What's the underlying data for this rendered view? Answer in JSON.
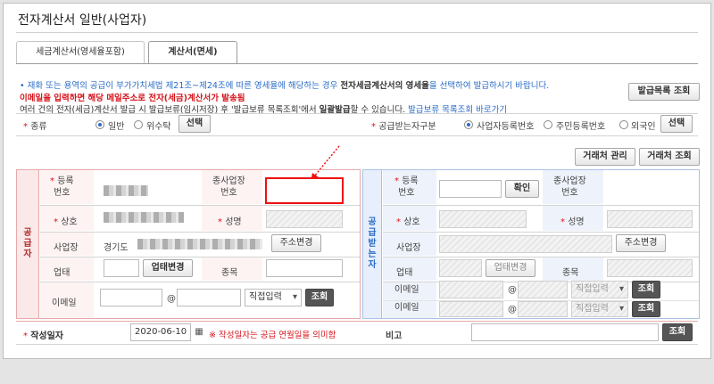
{
  "title": "전자계산서 일반(사업자)",
  "tabs": [
    "세금계산서(영세율포함)",
    "계산서(면세)"
  ],
  "notice": {
    "line1_prefix": "• 재화 또는 용역의 공급이 부가가치세법 제21조~제24조에 따른 영세율에 해당하는 경우 ",
    "line1_bold": "전자세금계산서의 영세율",
    "line1_suffix": "을 선택하여 발급하시기 바랍니다.",
    "line2": "이메일을 입력하면 해당 메일주소로 전자(세금)계산서가 발송됨",
    "line3_prefix": "여러 건의 전자(세금)계산서 발급 시 발급보류(임시저장) 후 '발급보류 목록조회'에서 ",
    "line3_bold": "일괄발급",
    "line3_mid": "할 수 있습니다. ",
    "line3_link": "발급보류 목록조회 바로가기"
  },
  "buttons": {
    "issue_list": "발급목록 조회",
    "select": "선택",
    "client_manage": "거래처 관리",
    "client_search": "거래처 조회",
    "confirm": "확인",
    "address_change": "주소변경",
    "business_change": "업태변경",
    "search": "조회"
  },
  "type_row": {
    "label": "종류",
    "options": [
      "일반",
      "위수탁"
    ],
    "selected": "일반",
    "receiver_label": "공급받는자구분",
    "receiver_options": [
      "사업자등록번호",
      "주민등록번호",
      "외국인"
    ],
    "receiver_selected": "사업자등록번호"
  },
  "supplier": {
    "side_label": [
      "공",
      "급",
      "자"
    ],
    "reg_no_label": [
      "등록",
      "번호"
    ],
    "branch_label": [
      "종사업장",
      "번호"
    ],
    "company_label": "상호",
    "name_label": "성명",
    "address_label": "사업장",
    "address_value": "경기도",
    "business_label": "업태",
    "item_label": "종목",
    "email_label": "이메일",
    "email_at": "@",
    "email_domain_select": "직접입력"
  },
  "receiver": {
    "side_label": [
      "공",
      "급",
      "받",
      "는",
      "자"
    ],
    "reg_no_label": [
      "등록",
      "번호"
    ],
    "branch_label": [
      "종사업장",
      "번호"
    ],
    "company_label": "상호",
    "name_label": "성명",
    "address_label": "사업장",
    "business_label": "업태",
    "item_label": "종목",
    "email_label": "이메일",
    "email_at": "@",
    "email_domain_select": "직접입력"
  },
  "date_row": {
    "label": "작성일자",
    "value": "2020-06-10",
    "note": "※ 작성일자는 공급 연월일을 의미함",
    "remark_label": "비고"
  },
  "colors": {
    "accent_red": "#d6141c",
    "accent_blue": "#2a6cc7",
    "supplier_bg": "#fbe9e9",
    "receiver_bg": "#e7effc"
  }
}
